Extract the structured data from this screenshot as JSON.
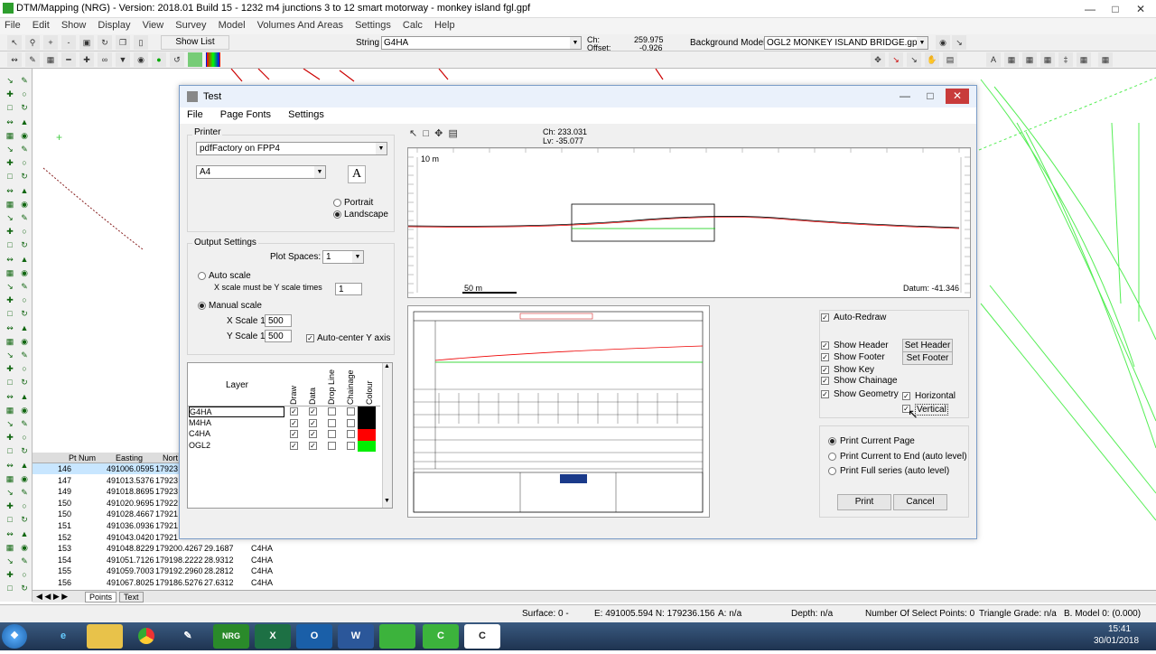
{
  "app": {
    "title": "DTM/Mapping (NRG) - Version: 2018.01 Build 15 - 1232 m4 junctions 3 to 12 smart motorway - monkey island fgl.gpf",
    "menu": [
      "File",
      "Edit",
      "Show",
      "Display",
      "View",
      "Survey",
      "Model",
      "Volumes And Areas",
      "Settings",
      "Calc",
      "Help"
    ],
    "toolbar": {
      "show_list": "Show List",
      "string_label": "String",
      "string_value": "G4HA",
      "ch_label": "Ch:",
      "offset_label": "Offset:",
      "ch_value": "259.975",
      "offset_value": "-0.926",
      "bg_model_label": "Background Model:",
      "bg_model_value": "OGL2 MONKEY ISLAND BRIDGE.gpf"
    }
  },
  "dialog": {
    "title": "Test",
    "menu": [
      "File",
      "Page Fonts",
      "Settings"
    ],
    "printer_group": "Printer",
    "printer_value": "pdfFactory on FPP4",
    "paper_value": "A4",
    "font_button": "A",
    "portrait": "Portrait",
    "landscape": "Landscape",
    "output_group": "Output Settings",
    "plot_spaces_label": "Plot Spaces:",
    "plot_spaces_value": "1",
    "auto_scale": "Auto scale",
    "x_scale_must": "X scale must be Y scale times",
    "x_scale_times_value": "1",
    "manual_scale": "Manual scale",
    "x_scale_label": "X Scale 1:",
    "x_scale_value": "500",
    "y_scale_label": "Y Scale 1:",
    "y_scale_value": "500",
    "auto_center": "Auto-center Y axis",
    "layer_header": "Layer",
    "layer_columns": [
      "Draw",
      "Data",
      "Drop Line",
      "Chainage",
      "Colour"
    ],
    "layers": [
      {
        "name": "G4HA",
        "colour": "#000000"
      },
      {
        "name": "M4HA",
        "colour": "#000000"
      },
      {
        "name": "C4HA",
        "colour": "#ff0000"
      },
      {
        "name": "OGL2",
        "colour": "#00ee00"
      }
    ],
    "cursor_ch": "Ch: 233.031",
    "cursor_lv": "Lv: -35.077",
    "scale_10m": "10 m",
    "scale_50m": "50 m",
    "datum": "Datum: -41.346",
    "auto_redraw": "Auto-Redraw",
    "show_header": "Show Header",
    "show_footer": "Show Footer",
    "show_key": "Show Key",
    "show_chainage": "Show Chainage",
    "show_geometry": "Show Geometry",
    "set_header": "Set Header",
    "set_footer": "Set Footer",
    "horizontal": "Horizontal",
    "vertical": "Vertical",
    "print_current_page": "Print Current Page",
    "print_current_to_end": "Print Current to End (auto level)",
    "print_full_series": "Print Full series (auto level)",
    "print_button": "Print",
    "cancel_button": "Cancel"
  },
  "grid": {
    "columns": [
      "Pt Num",
      "Easting",
      "Nort"
    ],
    "rows": [
      {
        "num": "146",
        "e": "491006.0595",
        "n": "17923",
        "z": "",
        "s": ""
      },
      {
        "num": "147",
        "e": "491013.5376",
        "n": "17923",
        "z": "",
        "s": ""
      },
      {
        "num": "149",
        "e": "491018.8695",
        "n": "17923",
        "z": "",
        "s": ""
      },
      {
        "num": "150",
        "e": "491020.9695",
        "n": "17922",
        "z": "",
        "s": ""
      },
      {
        "num": "150",
        "e": "491028.4667",
        "n": "17921",
        "z": "",
        "s": ""
      },
      {
        "num": "151",
        "e": "491036.0936",
        "n": "17921",
        "z": "",
        "s": ""
      },
      {
        "num": "152",
        "e": "491043.0420",
        "n": "17921",
        "z": "",
        "s": ""
      },
      {
        "num": "153",
        "e": "491048.8229",
        "n": "179200.4267",
        "z": "29.1687",
        "s": "C4HA"
      },
      {
        "num": "154",
        "e": "491051.7126",
        "n": "179198.2222",
        "z": "28.9312",
        "s": "C4HA"
      },
      {
        "num": "155",
        "e": "491059.7003",
        "n": "179192.2960",
        "z": "28.2812",
        "s": "C4HA"
      },
      {
        "num": "156",
        "e": "491067.8025",
        "n": "179186.5276",
        "z": "27.6312",
        "s": "C4HA"
      }
    ],
    "tabs": [
      "Points",
      "Text"
    ]
  },
  "status": {
    "surface": "Surface: 0 -",
    "en": "E: 491005.594  N: 179236.156",
    "a": "A: n/a",
    "depth": "Depth: n/a",
    "num_select": "Number Of Select Points: 0",
    "triangle": "Triangle Grade: n/a",
    "bmodel": "B. Model 0: (0.000)"
  },
  "taskbar": {
    "time": "15:41",
    "date": "30/01/2018",
    "apps": [
      "start",
      "ie",
      "explorer",
      "chrome",
      "paint",
      "nrg",
      "excel",
      "outlook",
      "word",
      "dtm",
      "calc",
      "c"
    ]
  }
}
